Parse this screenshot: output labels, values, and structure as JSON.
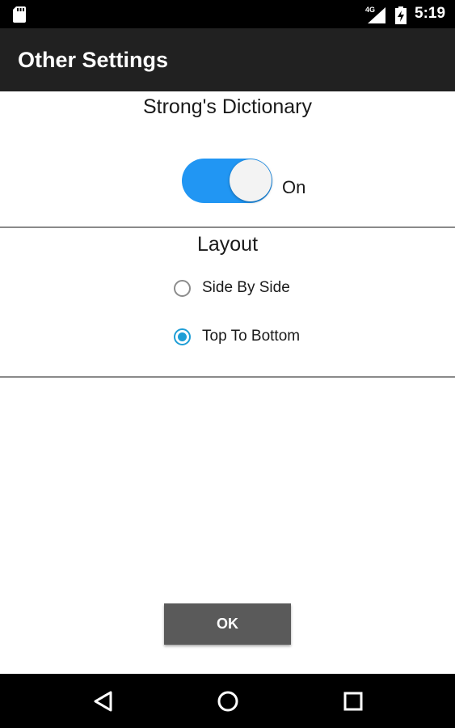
{
  "status_bar": {
    "network_label": "4G",
    "time": "5:19",
    "icons": [
      "sd-card-icon",
      "signal-icon",
      "battery-icon"
    ]
  },
  "app_bar": {
    "title": "Other Settings"
  },
  "strongs": {
    "title": "Strong's Dictionary",
    "toggle_state": "On",
    "enabled": true
  },
  "layout": {
    "title": "Layout",
    "options": [
      {
        "label": "Side By Side",
        "selected": false
      },
      {
        "label": "Top To Bottom",
        "selected": true
      }
    ]
  },
  "actions": {
    "ok_label": "OK"
  },
  "nav_bar": {
    "buttons": [
      "back-icon",
      "home-icon",
      "recents-icon"
    ]
  },
  "colors": {
    "accent": "#2196f3",
    "radio_accent": "#1f9ed6",
    "app_bar": "#212121",
    "button": "#5a5a5a"
  }
}
